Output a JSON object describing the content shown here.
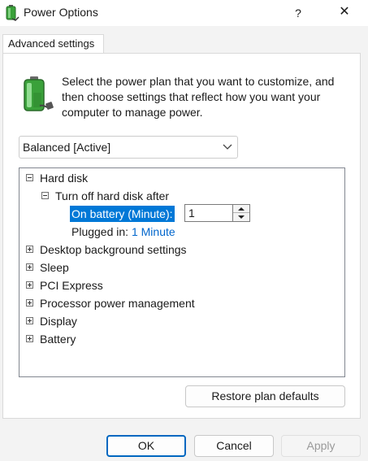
{
  "window": {
    "title": "Power Options",
    "help_label": "?",
    "close_label": "✕"
  },
  "tabs": [
    {
      "label": "Advanced settings",
      "selected": true
    }
  ],
  "description": "Select the power plan that you want to customize, and then choose settings that reflect how you want your computer to manage power.",
  "plan_select": {
    "value": "Balanced [Active]"
  },
  "tree": {
    "hard_disk": {
      "label": "Hard disk",
      "expanded": true
    },
    "turn_off": {
      "label": "Turn off hard disk after",
      "expanded": true
    },
    "on_battery": {
      "label": "On battery (Minute):",
      "value": "1"
    },
    "plugged_in": {
      "label": "Plugged in:",
      "value": "1 Minute"
    },
    "collapsed_items": [
      "Desktop background settings",
      "Sleep",
      "PCI Express",
      "Processor power management",
      "Display",
      "Battery"
    ]
  },
  "buttons": {
    "restore": "Restore plan defaults",
    "ok": "OK",
    "cancel": "Cancel",
    "apply": "Apply"
  },
  "colors": {
    "accent": "#0078d7",
    "link": "#0066cc",
    "battery_green": "#3aa13a"
  },
  "icons": {
    "app": "power-options-battery-icon",
    "header": "battery-plug-icon"
  }
}
